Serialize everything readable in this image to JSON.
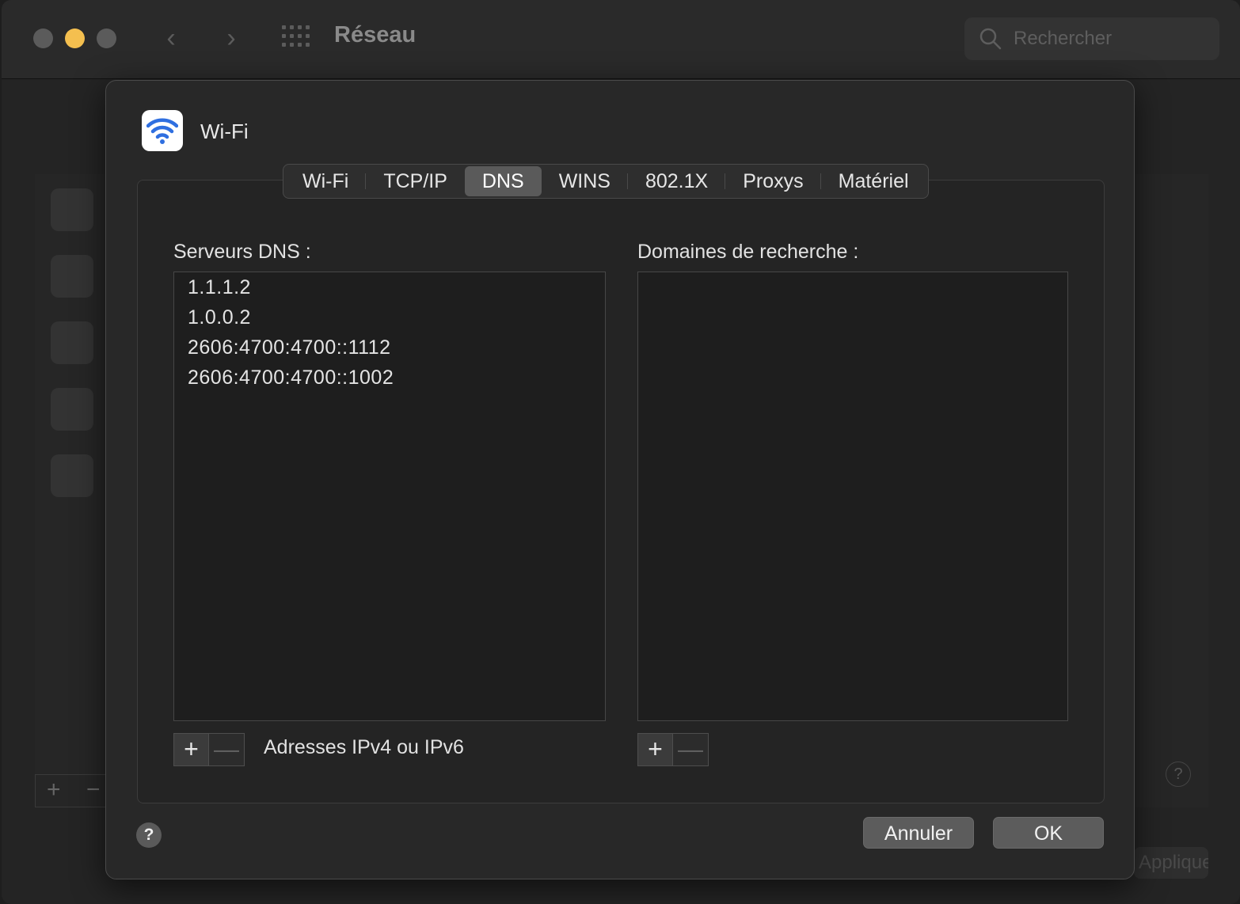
{
  "window": {
    "title": "Réseau",
    "search_placeholder": "Rechercher",
    "back_glyph": "‹",
    "forward_glyph": "›",
    "bg_add_glyph": "+",
    "bg_remove_glyph": "−",
    "bg_help_glyph": "?",
    "bg_apply_label": "Appliquer"
  },
  "sheet": {
    "title": "Wi-Fi",
    "icon": "wifi-icon",
    "tabs": [
      {
        "label": "Wi-Fi",
        "active": false
      },
      {
        "label": "TCP/IP",
        "active": false
      },
      {
        "label": "DNS",
        "active": true
      },
      {
        "label": "WINS",
        "active": false
      },
      {
        "label": "802.1X",
        "active": false
      },
      {
        "label": "Proxys",
        "active": false
      },
      {
        "label": "Matériel",
        "active": false
      }
    ],
    "dns": {
      "servers_label": "Serveurs DNS :",
      "servers": [
        "1.1.1.2",
        "1.0.0.2",
        "2606:4700:4700::1112",
        "2606:4700:4700::1002"
      ],
      "servers_hint": "Adresses IPv4 ou IPv6",
      "search_domains_label": "Domaines de recherche :",
      "search_domains": [],
      "add_glyph": "+",
      "remove_glyph": "—"
    },
    "help_glyph": "?",
    "cancel_label": "Annuler",
    "ok_label": "OK"
  },
  "colors": {
    "traffic_minimize": "#f4bf4f",
    "wifi_blue": "#2f6fe0",
    "active_tab": "#5a5a5a"
  }
}
